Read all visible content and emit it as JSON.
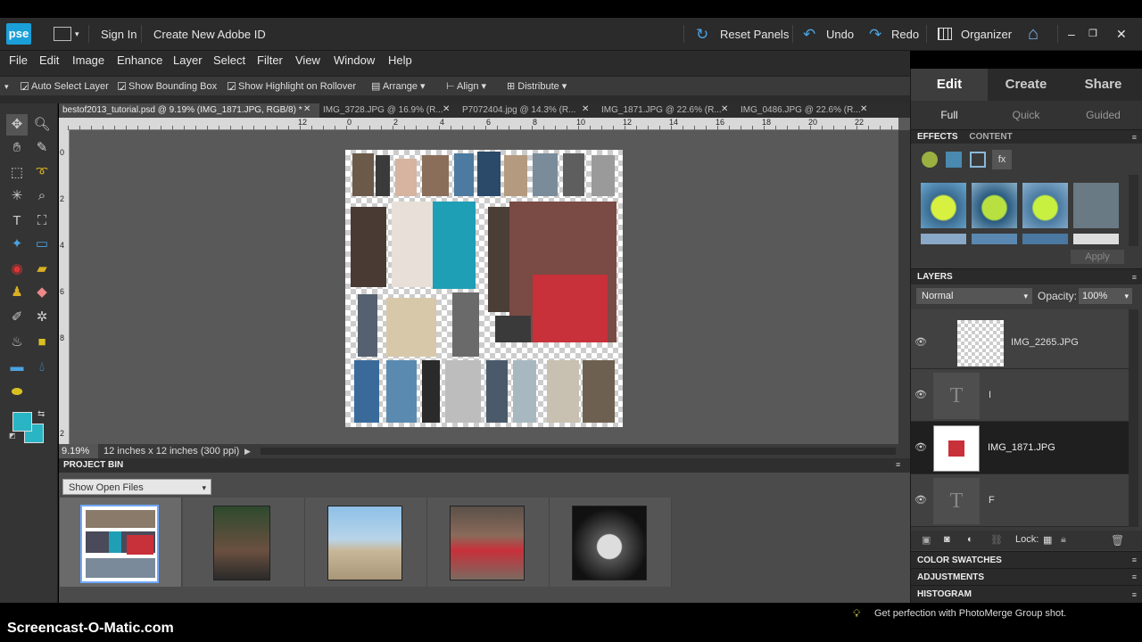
{
  "app": {
    "logo_text": "pse",
    "sign_in": "Sign In",
    "create_id": "Create New Adobe ID",
    "reset_panels": "Reset Panels",
    "undo": "Undo",
    "redo": "Redo",
    "organizer": "Organizer"
  },
  "menu": [
    "File",
    "Edit",
    "Image",
    "Enhance",
    "Layer",
    "Select",
    "Filter",
    "View",
    "Window",
    "Help"
  ],
  "options": {
    "auto_select": "Auto Select Layer",
    "bounding_box": "Show Bounding Box",
    "highlight": "Show Highlight on Rollover",
    "arrange": "Arrange",
    "align": "Align",
    "distribute": "Distribute"
  },
  "tabs": [
    "bestof2013_tutorial.psd @ 9.19% (IMG_1871.JPG, RGB/8) *",
    "IMG_3728.JPG @ 16.9% (R...",
    "P7072404.jpg @ 14.3% (R...",
    "IMG_1871.JPG @ 22.6% (R...",
    "IMG_0486.JPG @ 22.6% (R..."
  ],
  "ruler_h": [
    "12",
    "0",
    "2",
    "4",
    "6",
    "8",
    "10",
    "12",
    "14",
    "16",
    "18",
    "20",
    "22"
  ],
  "ruler_v": [
    "0",
    "2",
    "4",
    "6",
    "8",
    "2"
  ],
  "status": {
    "zoom": "9.19%",
    "doc_info": "12 inches x 12 inches (300 ppi)"
  },
  "project_bin": {
    "title": "PROJECT BIN",
    "dropdown": "Show Open Files"
  },
  "right_panel": {
    "tabs": [
      "Edit",
      "Create",
      "Share"
    ],
    "subtabs": [
      "Full",
      "Quick",
      "Guided"
    ],
    "effects_tab": "EFFECTS",
    "content_tab": "CONTENT",
    "apply": "Apply",
    "layers_title": "LAYERS",
    "blend_mode": "Normal",
    "opacity_label": "Opacity:",
    "opacity_value": "100%",
    "layers": [
      {
        "name": "IMG_2265.JPG",
        "type": "image",
        "selected": false
      },
      {
        "name": "I",
        "type": "text",
        "selected": false
      },
      {
        "name": "IMG_1871.JPG",
        "type": "image",
        "selected": true
      },
      {
        "name": "F",
        "type": "text",
        "selected": false
      }
    ],
    "lock_label": "Lock:",
    "sections": [
      "COLOR SWATCHES",
      "ADJUSTMENTS",
      "HISTOGRAM"
    ]
  },
  "tip": "Get perfection with PhotoMerge Group shot.",
  "watermark": "Screencast-O-Matic.com",
  "colors": {
    "accent": "#1a9fd8",
    "foreground_swatch": "#29b5c4",
    "background_swatch": "#29b5c4"
  }
}
